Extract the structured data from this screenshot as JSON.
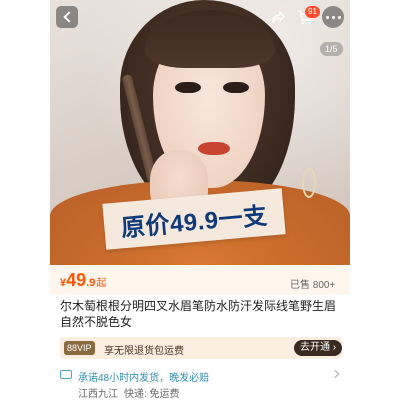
{
  "hero": {
    "counter": "1/5",
    "promo_text": "原价49.9一支",
    "cart_badge": "91"
  },
  "price": {
    "currency": "¥",
    "integer": "49",
    "decimal": ".9",
    "suffix": "起",
    "sold_label": "已售 800+"
  },
  "product": {
    "title": "尔木萄根根分明四叉水眉笔防水防汗发际线笔野生眉自然不脱色女"
  },
  "vip": {
    "tag": "88VIP",
    "text": "享无限退货包运费",
    "button": "去开通 ›"
  },
  "shipping": {
    "promise": "承诺48小时内发货，晚发必赔",
    "origin": "江西九江",
    "delivery": "快递: 免运费"
  },
  "colors": {
    "accent": "#ff5500",
    "price_bg": "#fff6ee",
    "vip_bg": "#fbeee1",
    "vip_btn": "#3a2a1f",
    "ship_text": "#2e8fb3"
  },
  "icons": [
    "back-icon",
    "share-icon",
    "cart-icon",
    "more-icon",
    "truck-icon",
    "chevron-right-icon"
  ]
}
